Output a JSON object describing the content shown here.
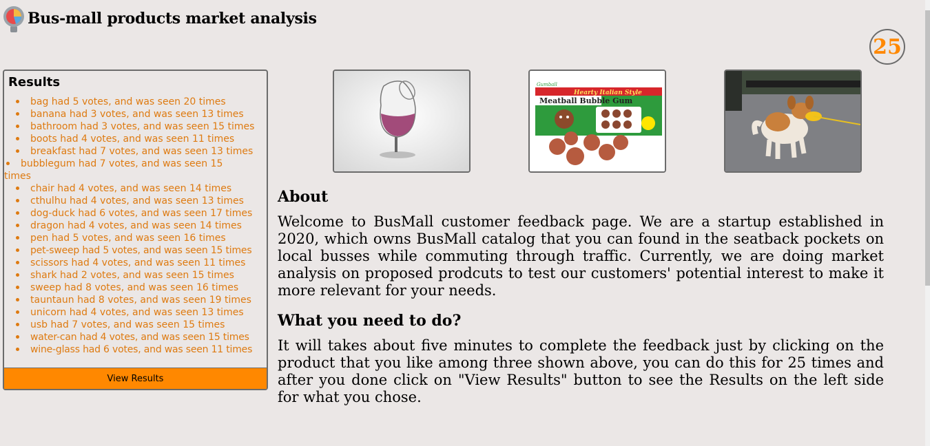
{
  "header": {
    "title": "Bus-mall products market analysis",
    "logo_icon": "pie-chart-marker-icon"
  },
  "round_counter": "25",
  "results": {
    "heading": "Results",
    "items": [
      "bag had 5 votes, and was seen 20 times",
      "banana had 3 votes, and was seen 13 times",
      "bathroom had 3 votes, and was seen 15 times",
      "boots had 4 votes, and was seen 11 times",
      "breakfast had 7 votes, and was seen 13 times",
      "bubblegum had 7 votes, and was seen 15 times",
      "chair had 4 votes, and was seen 14 times",
      "cthulhu had 4 votes, and was seen 13 times",
      "dog-duck had 6 votes, and was seen 17 times",
      "dragon had 4 votes, and was seen 14 times",
      "pen had 5 votes, and was seen 16 times",
      "pet-sweep had 5 votes, and was seen 15 times",
      "scissors had 4 votes, and was seen 11 times",
      "shark had 2 votes, and was seen 15 times",
      "sweep had 8 votes, and was seen 16 times",
      "tauntaun had 8 votes, and was seen 19 times",
      "unicorn had 4 votes, and was seen 13 times",
      "usb had 7 votes, and was seen 15 times",
      "water-can had 4 votes, and was seen 15 times",
      "wine-glass had 6 votes, and was seen 11 times"
    ],
    "button_label": "View Results"
  },
  "products": {
    "bubblegum_banner": "Hearty Italian Style",
    "bubblegum_name": "Meatball Bubble Gum"
  },
  "about": {
    "heading": "About",
    "text": "Welcome to BusMall customer feedback page. We are a startup established in 2020, which owns BusMall catalog that you can found in the seatback pockets on local busses while commuting through traffic. Currently, we are doing market analysis on proposed prodcuts to test our customers' potential interest to make it more relevant for your needs."
  },
  "instructions": {
    "heading": "What you need to do?",
    "text": "It will takes about five minutes to complete the feedback just by clicking on the product that you like among three shown above, you can do this for 25 times and after you done click on \"View Results\" button to see the Results on the left side for what you chose."
  },
  "colors": {
    "accent": "#ff8800",
    "list_text": "#de7a10",
    "background": "#ebe7e6",
    "border": "#6b6b6b"
  }
}
